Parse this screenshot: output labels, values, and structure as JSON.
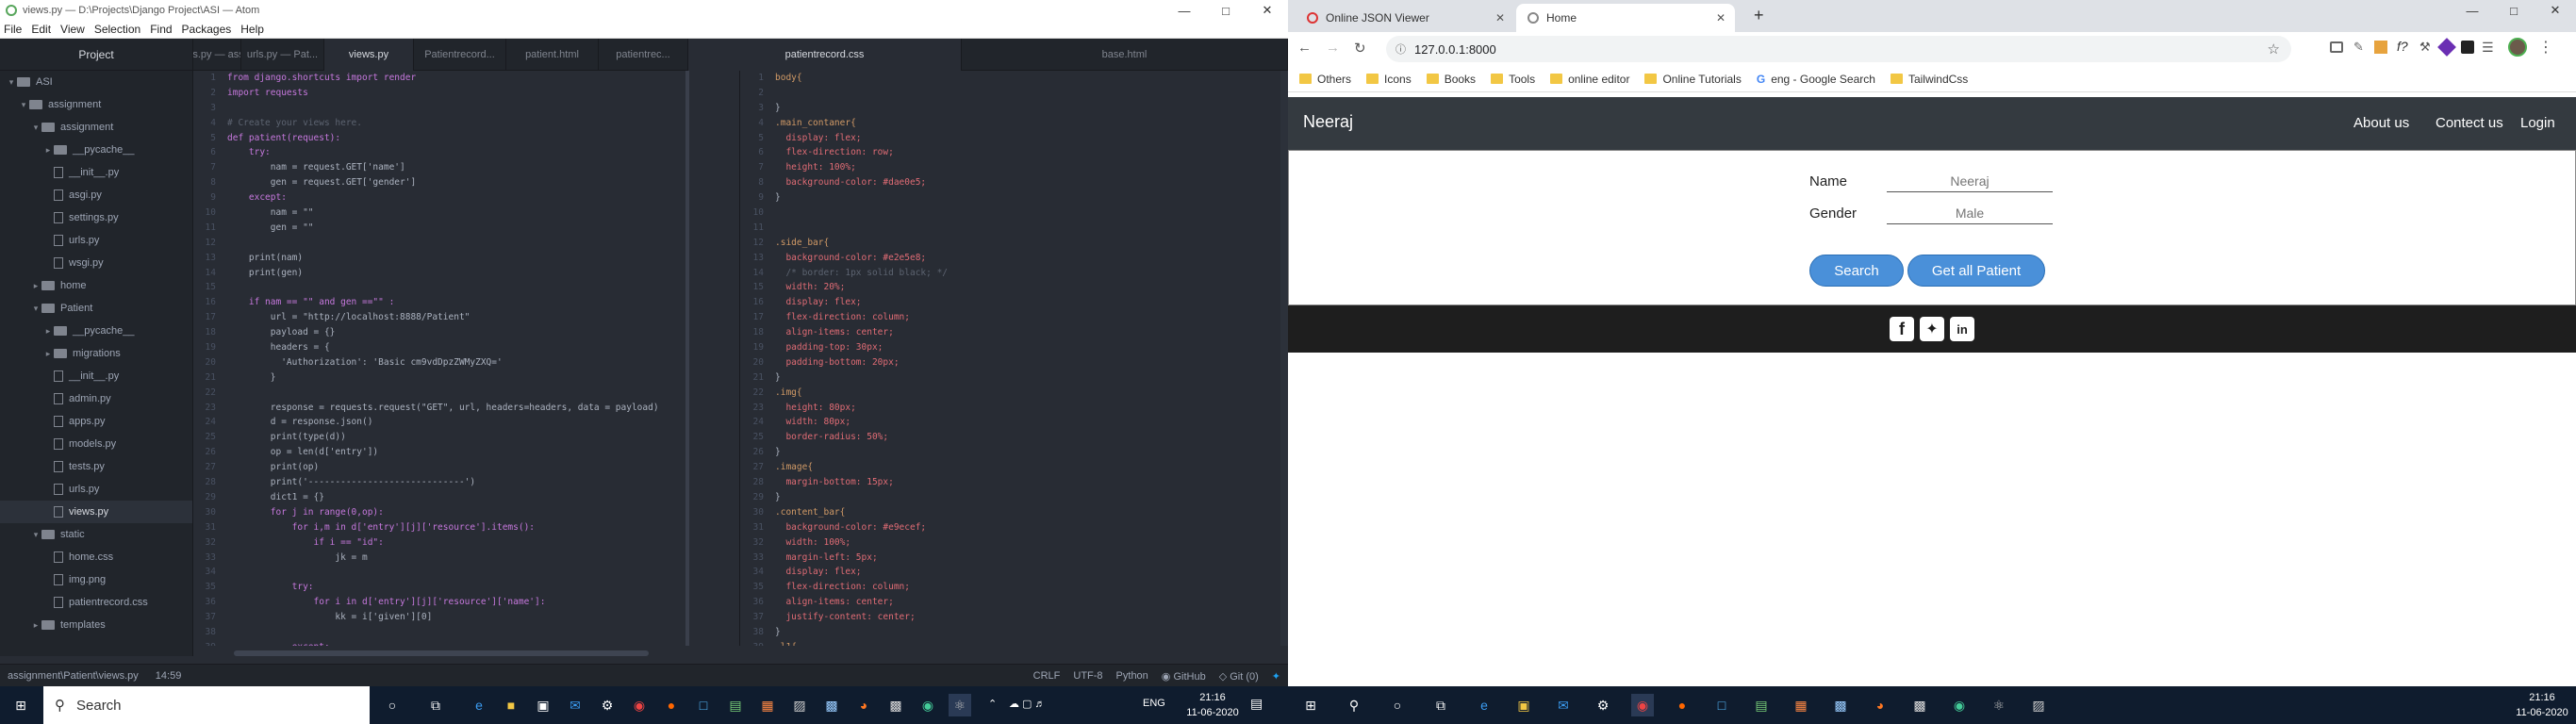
{
  "atom": {
    "window_title": "views.py — D:\\Projects\\Django Project\\ASI — Atom",
    "menu": [
      "File",
      "Edit",
      "View",
      "Selection",
      "Find",
      "Packages",
      "Help"
    ],
    "tree_header": "Project",
    "tree": [
      {
        "label": "ASI",
        "type": "folder",
        "depth": 0,
        "open": true
      },
      {
        "label": "assignment",
        "type": "folder",
        "depth": 1,
        "open": true
      },
      {
        "label": "assignment",
        "type": "folder",
        "depth": 2,
        "open": true
      },
      {
        "label": "__pycache__",
        "type": "folder",
        "depth": 3,
        "open": false
      },
      {
        "label": "__init__.py",
        "type": "file",
        "depth": 3
      },
      {
        "label": "asgi.py",
        "type": "file",
        "depth": 3
      },
      {
        "label": "settings.py",
        "type": "file",
        "depth": 3
      },
      {
        "label": "urls.py",
        "type": "file",
        "depth": 3
      },
      {
        "label": "wsgi.py",
        "type": "file",
        "depth": 3
      },
      {
        "label": "home",
        "type": "folder",
        "depth": 2,
        "open": false
      },
      {
        "label": "Patient",
        "type": "folder",
        "depth": 2,
        "open": true
      },
      {
        "label": "__pycache__",
        "type": "folder",
        "depth": 3,
        "open": false
      },
      {
        "label": "migrations",
        "type": "folder",
        "depth": 3,
        "open": false
      },
      {
        "label": "__init__.py",
        "type": "file",
        "depth": 3
      },
      {
        "label": "admin.py",
        "type": "file",
        "depth": 3
      },
      {
        "label": "apps.py",
        "type": "file",
        "depth": 3
      },
      {
        "label": "models.py",
        "type": "file",
        "depth": 3
      },
      {
        "label": "tests.py",
        "type": "file",
        "depth": 3
      },
      {
        "label": "urls.py",
        "type": "file",
        "depth": 3
      },
      {
        "label": "views.py",
        "type": "file",
        "depth": 3,
        "selected": true
      },
      {
        "label": "static",
        "type": "folder",
        "depth": 2,
        "open": true
      },
      {
        "label": "home.css",
        "type": "file",
        "depth": 3
      },
      {
        "label": "img.png",
        "type": "file",
        "depth": 3
      },
      {
        "label": "patientrecord.css",
        "type": "file",
        "depth": 3
      },
      {
        "label": "templates",
        "type": "folder",
        "depth": 2,
        "open": false
      }
    ],
    "left_tabs": [
      "urls.py — ass...",
      "urls.py — Pat...",
      "views.py",
      "Patientrecord...",
      "patient.html",
      "patientrec..."
    ],
    "left_active": 2,
    "right_tabs": [
      "patientrecord.css",
      "base.html"
    ],
    "right_active": 0,
    "left_code": [
      "from django.shortcuts import render",
      "import requests",
      "",
      "# Create your views here.",
      "def patient(request):",
      "    try:",
      "        nam = request.GET['name']",
      "        gen = request.GET['gender']",
      "    except:",
      "        nam = \"\"",
      "        gen = \"\"",
      "",
      "    print(nam)",
      "    print(gen)",
      "",
      "    if nam == \"\" and gen ==\"\" :",
      "        url = \"http://localhost:8888/Patient\"",
      "        payload = {}",
      "        headers = {",
      "          'Authorization': 'Basic cm9vdDpzZWMyZXQ='",
      "        }",
      "",
      "        response = requests.request(\"GET\", url, headers=headers, data = payload)",
      "        d = response.json()",
      "        print(type(d))",
      "        op = len(d['entry'])",
      "        print(op)",
      "        print('-----------------------------')",
      "        dict1 = {}",
      "        for j in range(0,op):",
      "            for i,m in d['entry'][j]['resource'].items():",
      "                if i == \"id\":",
      "                    jk = m",
      "",
      "            try:",
      "                for i in d['entry'][j]['resource']['name']:",
      "                    kk = i['given'][0]",
      "",
      "            except:"
    ],
    "right_code": [
      "body{",
      "",
      "}",
      ".main_contaner{",
      "  display: flex;",
      "  flex-direction: row;",
      "  height: 100%;",
      "  background-color: #dae0e5;",
      "}",
      "",
      "",
      ".side_bar{",
      "  background-color: #e2e5e8;",
      "  /* border: 1px solid black; */",
      "  width: 20%;",
      "  display: flex;",
      "  flex-direction: column;",
      "  align-items: center;",
      "  padding-top: 30px;",
      "  padding-bottom: 20px;",
      "}",
      ".img{",
      "  height: 80px;",
      "  width: 80px;",
      "  border-radius: 50%;",
      "}",
      ".image{",
      "  margin-bottom: 15px;",
      "}",
      ".content_bar{",
      "  background-color: #e9ecef;",
      "  width: 100%;",
      "  margin-left: 5px;",
      "  display: flex;",
      "  flex-direction: column;",
      "  align-items: center;",
      "  justify-content: center;",
      "}",
      ".l1{"
    ],
    "status": {
      "path": "assignment\\Patient\\views.py",
      "cursor": "14:59",
      "crlf": "CRLF",
      "encoding": "UTF-8",
      "grammar": "Python",
      "github": "GitHub",
      "git": "Git (0)"
    }
  },
  "chrome": {
    "tabs": [
      {
        "title": "Online JSON Viewer"
      },
      {
        "title": "Home"
      }
    ],
    "active_tab": 1,
    "url": "127.0.0.1:8000",
    "bookmarks": [
      "Others",
      "Icons",
      "Books",
      "Tools",
      "online editor",
      "Online Tutorials",
      "eng - Google Search",
      "TailwindCss"
    ],
    "site": {
      "brand": "Neeraj",
      "nav": [
        "About us",
        "Contect us",
        "Login"
      ],
      "name_label": "Name",
      "name_placeholder": "Neeraj",
      "gender_label": "Gender",
      "gender_placeholder": "Male",
      "search_btn": "Search",
      "all_btn": "Get all Patient"
    }
  },
  "taskbar": {
    "search_placeholder": "Search",
    "tray_lang": "ENG",
    "left_time": "21:16",
    "left_date": "11-06-2020",
    "right_time": "21:16",
    "right_date": "11-06-2020"
  },
  "colors": {
    "atom_bg": "#282c34",
    "navbar": "#343a40",
    "button": "#4a90d9",
    "footer": "#1e1e1e",
    "taskbar": "#0f1c2e"
  }
}
